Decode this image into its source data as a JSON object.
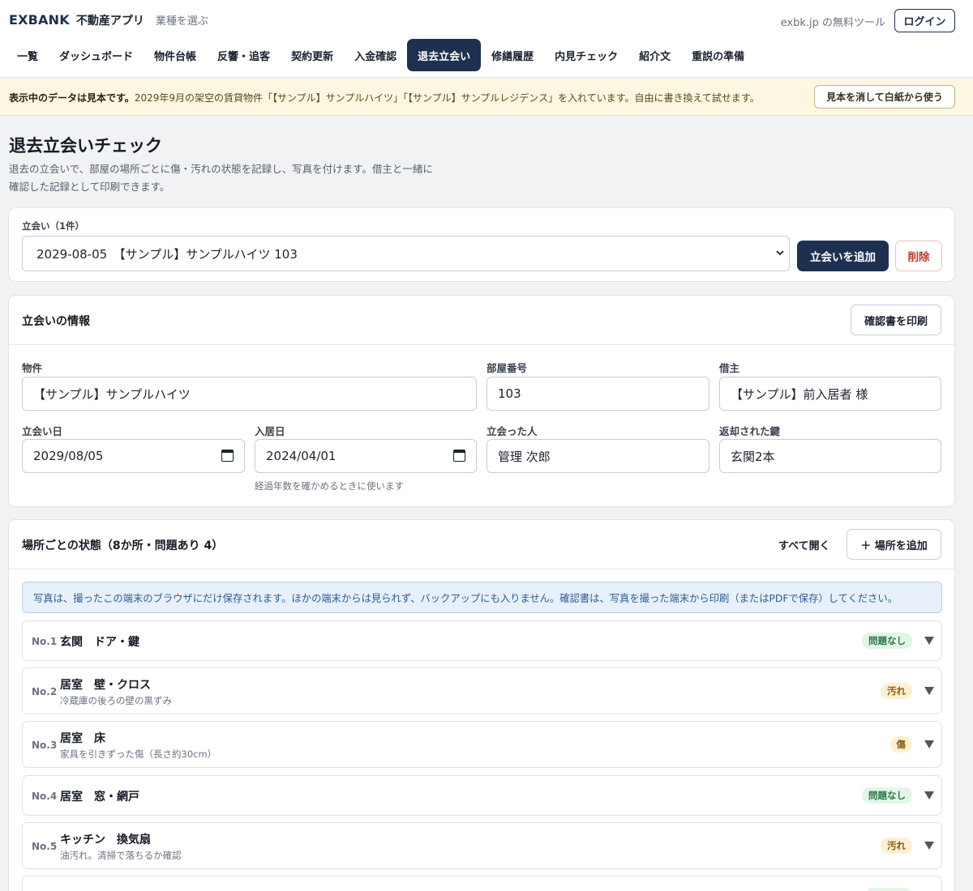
{
  "header": {
    "brand": "EXBANK",
    "app_name": "不動産アプリ",
    "choose_industry": "業種を選ぶ",
    "tool_link": "exbk.jp の無料ツール",
    "login": "ログイン"
  },
  "nav": {
    "items": [
      {
        "label": "一覧"
      },
      {
        "label": "ダッシュボード"
      },
      {
        "label": "物件台帳"
      },
      {
        "label": "反響・追客"
      },
      {
        "label": "契約更新"
      },
      {
        "label": "入金確認"
      },
      {
        "label": "退去立会い",
        "active": true
      },
      {
        "label": "修繕履歴"
      },
      {
        "label": "内見チェック"
      },
      {
        "label": "紹介文"
      },
      {
        "label": "重説の準備"
      }
    ]
  },
  "banner": {
    "bold": "表示中のデータは見本です。",
    "text": "2029年9月の架空の賃貸物件「【サンプル】サンプルハイツ」「【サンプル】サンプルレジデンス」を入れています。自由に書き換えて試せます。",
    "button": "見本を消して白紙から使う"
  },
  "page": {
    "title": "退去立会いチェック",
    "desc_line1": "退去の立会いで、部屋の場所ごとに傷・汚れの状態を記録し、写真を付けます。借主と一緒に",
    "desc_line2": "確認した記録として印刷できます。"
  },
  "selector": {
    "label": "立会い（1件）",
    "selected": "2029-08-05　【サンプル】サンプルハイツ 103",
    "add_button": "立会いを追加",
    "delete_button": "削除"
  },
  "info": {
    "title": "立会いの情報",
    "print_button": "確認書を印刷",
    "property_label": "物件",
    "property_value": "【サンプル】サンプルハイツ",
    "room_label": "部屋番号",
    "room_value": "103",
    "tenant_label": "借主",
    "tenant_value": "【サンプル】前入居者 様",
    "date_label": "立会い日",
    "date_value": "2029/08/05",
    "movein_label": "入居日",
    "movein_value": "2024/04/01",
    "movein_hint": "経過年数を確かめるときに使います",
    "attendee_label": "立会った人",
    "attendee_value": "管理 次郎",
    "keys_label": "返却された鍵",
    "keys_value": "玄関2本"
  },
  "locations": {
    "title": "場所ごとの状態（8か所・問題あり 4）",
    "expand_all": "すべて開く",
    "add_button": "＋ 場所を追加",
    "notice": "写真は、撮ったこの端末のブラウザにだけ保存されます。ほかの端末からは見られず、バックアップにも入りません。確認書は、写真を撮った端末から印刷（またはPDFで保存）してください。",
    "items": [
      {
        "no": "No.1",
        "name": "玄関　ドア・鍵",
        "note": "",
        "status": "問題なし"
      },
      {
        "no": "No.2",
        "name": "居室　壁・クロス",
        "note": "冷蔵庫の後ろの壁の黒ずみ",
        "status": "汚れ"
      },
      {
        "no": "No.3",
        "name": "居室　床",
        "note": "家具を引きずった傷（長さ約30cm）",
        "status": "傷"
      },
      {
        "no": "No.4",
        "name": "居室　窓・網戸",
        "note": "",
        "status": "問題なし"
      },
      {
        "no": "No.5",
        "name": "キッチン　換気扇",
        "note": "油汚れ。清掃で落ちるか確認",
        "status": "汚れ"
      }
    ]
  },
  "colors": {
    "navy": "#1d3050",
    "ok_badge": "#2d7a46",
    "warn_badge": "#8a5b10",
    "danger": "#c0392b"
  }
}
